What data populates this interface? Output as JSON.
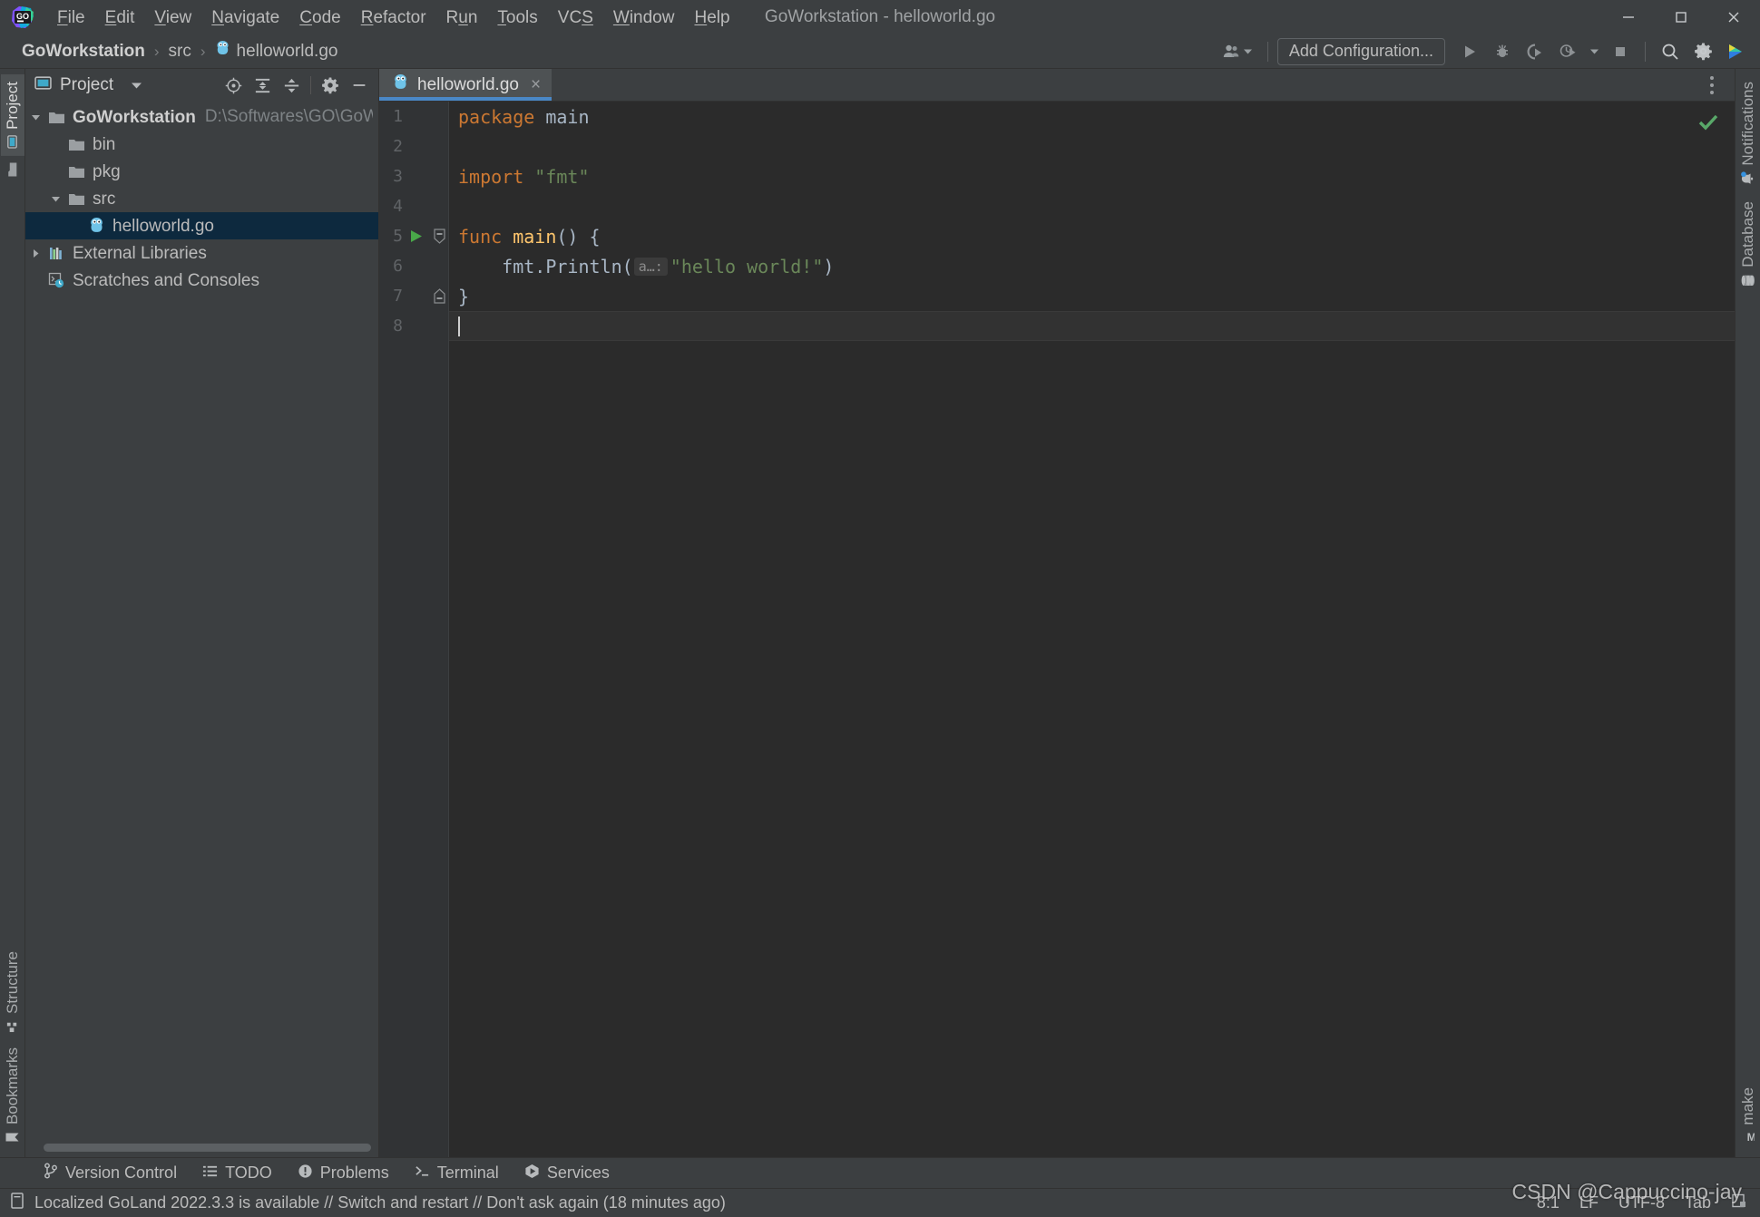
{
  "window": {
    "title": "GoWorkstation - helloworld.go",
    "minimize_label": "Minimize",
    "maximize_label": "Maximize",
    "close_label": "Close"
  },
  "menu": [
    {
      "label": "File",
      "mnemonic": "F"
    },
    {
      "label": "Edit",
      "mnemonic": "E"
    },
    {
      "label": "View",
      "mnemonic": "V"
    },
    {
      "label": "Navigate",
      "mnemonic": "N"
    },
    {
      "label": "Code",
      "mnemonic": "C"
    },
    {
      "label": "Refactor",
      "mnemonic": "R"
    },
    {
      "label": "Run",
      "mnemonic": "u"
    },
    {
      "label": "Tools",
      "mnemonic": "T"
    },
    {
      "label": "VCS",
      "mnemonic": "S"
    },
    {
      "label": "Window",
      "mnemonic": "W"
    },
    {
      "label": "Help",
      "mnemonic": "H"
    }
  ],
  "navbar": {
    "breadcrumbs": [
      "GoWorkstation",
      "src",
      "helloworld.go"
    ],
    "separator": "›",
    "add_configuration": "Add Configuration...",
    "icons": {
      "user": "user-group-icon",
      "run": "run-icon",
      "debug": "debug-icon",
      "run_coverage": "run-with-coverage-icon",
      "profile": "profile-icon",
      "profile_dropdown": "chevron-down-icon",
      "stop": "stop-icon",
      "search": "search-everywhere-icon",
      "settings": "settings-gear-icon",
      "ide_assistant": "ide-feature-trainer-icon"
    }
  },
  "left_strip": {
    "top": [
      {
        "label": "Project",
        "icon": "project-folder-icon",
        "selected": true
      }
    ],
    "bottom": [
      {
        "label": "Structure",
        "icon": "structure-icon",
        "selected": false
      },
      {
        "label": "Bookmarks",
        "icon": "bookmark-icon",
        "selected": false
      }
    ]
  },
  "right_strip": {
    "top": [
      {
        "label": "Notifications",
        "icon": "bell-icon"
      },
      {
        "label": "Database",
        "icon": "database-icon"
      }
    ],
    "bottom": [
      {
        "label": "make",
        "icon": "makefile-m-icon"
      }
    ]
  },
  "project_panel": {
    "title": "Project",
    "dropdown_icon": "chevron-down-icon",
    "actions": [
      {
        "name": "select-opened-file-icon",
        "tooltip": "Select Opened File"
      },
      {
        "name": "expand-all-icon",
        "tooltip": "Expand All"
      },
      {
        "name": "collapse-all-icon",
        "tooltip": "Collapse All"
      },
      {
        "name": "settings-gear-icon",
        "tooltip": "Settings"
      },
      {
        "name": "hide-icon",
        "tooltip": "Hide"
      }
    ],
    "tree": [
      {
        "label": "GoWorkstation",
        "sub": "D:\\Softwares\\GO\\GoWorkstation",
        "icon": "folder-icon",
        "depth": 0,
        "arrow": "expanded",
        "bold": true,
        "selected": false
      },
      {
        "label": "bin",
        "sub": "",
        "icon": "folder-icon",
        "depth": 1,
        "arrow": "none",
        "bold": false,
        "selected": false
      },
      {
        "label": "pkg",
        "sub": "",
        "icon": "folder-icon",
        "depth": 1,
        "arrow": "none",
        "bold": false,
        "selected": false
      },
      {
        "label": "src",
        "sub": "",
        "icon": "folder-icon",
        "depth": 1,
        "arrow": "expanded",
        "bold": false,
        "selected": false
      },
      {
        "label": "helloworld.go",
        "sub": "",
        "icon": "go-file-icon",
        "depth": 2,
        "arrow": "none",
        "bold": false,
        "selected": true
      },
      {
        "label": "External Libraries",
        "sub": "",
        "icon": "library-icon",
        "depth": 0,
        "arrow": "collapsed",
        "bold": false,
        "selected": false
      },
      {
        "label": "Scratches and Consoles",
        "sub": "",
        "icon": "scratches-icon",
        "depth": 0,
        "arrow": "none",
        "bold": false,
        "selected": false
      }
    ]
  },
  "editor": {
    "tab": {
      "label": "helloworld.go",
      "icon": "go-file-icon",
      "close": "×"
    },
    "options_icon": "more-vertical-icon",
    "inspection_status": "ok-check-icon",
    "line_count": 8,
    "current_line": 8,
    "lines": [
      {
        "n": "1",
        "run": false,
        "fold": "none",
        "current": false
      },
      {
        "n": "2",
        "run": false,
        "fold": "none",
        "current": false
      },
      {
        "n": "3",
        "run": false,
        "fold": "none",
        "current": false
      },
      {
        "n": "4",
        "run": false,
        "fold": "none",
        "current": false
      },
      {
        "n": "5",
        "run": true,
        "fold": "open",
        "current": false
      },
      {
        "n": "6",
        "run": false,
        "fold": "none",
        "current": false
      },
      {
        "n": "7",
        "run": false,
        "fold": "end",
        "current": false
      },
      {
        "n": "8",
        "run": false,
        "fold": "none",
        "current": true
      }
    ],
    "code": {
      "l1_kw": "package",
      "l1_name": "main",
      "l3_kw": "import",
      "l3_str": "\"fmt\"",
      "l5_kw": "func",
      "l5_fn": "main",
      "l5_tail": "() {",
      "l6_recv": "fmt",
      "l6_dot": ".",
      "l6_call": "Println",
      "l6_open": "(",
      "l6_hint": "a…:",
      "l6_str": "\"hello world!\"",
      "l6_close": ")",
      "l7": "}",
      "l8": ""
    }
  },
  "tool_windows": [
    {
      "label": "Version Control",
      "icon": "branch-icon"
    },
    {
      "label": "TODO",
      "icon": "todo-list-icon"
    },
    {
      "label": "Problems",
      "icon": "problems-icon"
    },
    {
      "label": "Terminal",
      "icon": "terminal-icon"
    },
    {
      "label": "Services",
      "icon": "services-icon"
    }
  ],
  "statusbar": {
    "icon": "event-log-icon",
    "message": "Localized GoLand 2022.3.3 is available // Switch and restart // Don't ask again (18 minutes ago)",
    "caret_position": "8:1",
    "line_separator": "LF",
    "encoding": "UTF-8",
    "indent": "Tab",
    "lock_icon": "read-only-toggle-icon"
  },
  "watermark": "CSDN @Cappuccino-jay",
  "colors": {
    "chrome": "#3c3f41",
    "editor_bg": "#2b2b2b",
    "gutter_bg": "#313335",
    "selection": "#0d293e",
    "tab_underline": "#4a88c7",
    "keyword": "#cc7832",
    "string": "#6a8759",
    "function": "#ffc66d",
    "identifier": "#a9b7c6",
    "run_green": "#49a849"
  }
}
